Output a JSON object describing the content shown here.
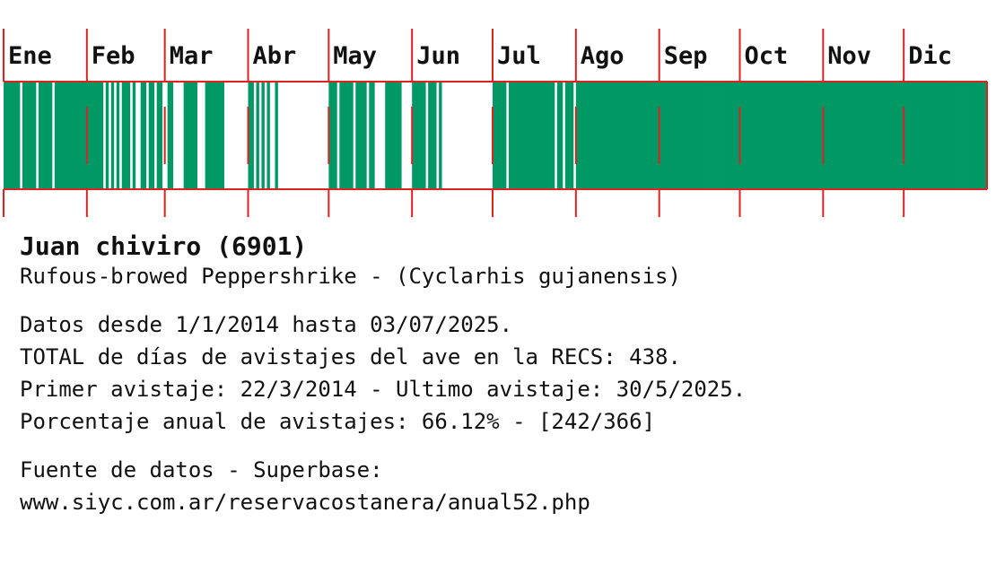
{
  "chart_data": {
    "type": "bar",
    "categories": [
      "Ene",
      "Feb",
      "Mar",
      "Abr",
      "May",
      "Jun",
      "Jul",
      "Ago",
      "Sep",
      "Oct",
      "Nov",
      "Dic"
    ],
    "month_days": [
      31,
      29,
      31,
      30,
      31,
      30,
      31,
      31,
      30,
      31,
      30,
      31
    ],
    "sighting_days": [
      [
        1,
        2,
        3,
        4,
        5,
        6,
        8,
        9,
        10,
        11,
        12,
        14,
        15,
        16,
        17,
        18,
        20,
        21,
        22,
        23,
        24,
        25,
        26,
        27,
        28,
        29,
        30,
        31
      ],
      [
        1,
        2,
        3,
        4,
        5,
        6,
        8,
        10,
        12,
        14,
        15,
        16,
        18,
        21,
        22,
        24,
        25,
        27,
        28
      ],
      [
        2,
        3,
        8,
        9,
        10,
        11,
        12,
        16,
        17,
        18,
        19,
        20,
        21,
        22
      ],
      [
        1,
        2,
        4,
        6,
        8,
        11
      ],
      [
        1,
        2,
        3,
        5,
        6,
        7,
        8,
        9,
        11,
        12,
        13,
        14,
        16,
        17,
        22,
        23,
        24,
        25,
        26,
        27
      ],
      [
        1,
        2,
        3,
        4,
        5,
        7,
        8,
        9,
        11
      ],
      [
        1,
        2,
        3,
        4,
        5,
        7,
        8,
        9,
        10,
        11,
        12,
        13,
        14,
        15,
        16,
        17,
        18,
        19,
        20,
        21,
        22,
        23,
        25,
        26,
        28,
        29,
        30
      ],
      [
        1,
        2,
        3,
        4,
        5,
        6,
        7,
        8,
        9,
        10,
        11,
        12,
        13,
        14,
        15,
        16,
        17,
        18,
        19,
        20,
        21,
        22,
        23,
        24,
        25,
        26,
        27,
        28,
        29,
        30,
        31
      ],
      [
        1,
        2,
        3,
        4,
        5,
        6,
        7,
        8,
        9,
        10,
        11,
        12,
        13,
        14,
        15,
        16,
        17,
        18,
        19,
        20,
        21,
        22,
        23,
        24,
        25,
        26,
        27,
        28,
        29,
        30
      ],
      [
        1,
        2,
        3,
        4,
        5,
        6,
        7,
        8,
        9,
        10,
        11,
        12,
        13,
        14,
        15,
        16,
        17,
        18,
        19,
        20,
        21,
        22,
        23,
        24,
        25,
        26,
        27,
        28,
        29,
        30,
        31
      ],
      [
        1,
        2,
        3,
        4,
        5,
        6,
        7,
        8,
        9,
        10,
        11,
        12,
        13,
        14,
        15,
        16,
        17,
        18,
        19,
        20,
        21,
        22,
        23,
        24,
        25,
        26,
        27,
        28,
        29,
        30
      ],
      [
        1,
        2,
        3,
        4,
        5,
        6,
        7,
        8,
        9,
        10,
        11,
        12,
        13,
        14,
        15,
        16,
        17,
        18,
        19,
        20,
        21,
        22,
        23,
        24,
        25,
        26,
        27,
        28,
        29,
        30,
        31
      ]
    ],
    "colors": {
      "bar": "#009966",
      "grid": "#dd2222",
      "background": "#ffffff",
      "text": "#111111"
    }
  },
  "species": {
    "common_name": "Juan chiviro (6901)",
    "scientific_line": "Rufous-browed Peppershrike - (Cyclarhis gujanensis)"
  },
  "stats": {
    "range": "Datos desde 1/1/2014 hasta 03/07/2025.",
    "total": "TOTAL de días de avistajes del ave en la RECS: 438.",
    "first_last": "Primer avistaje: 22/3/2014 - Ultimo avistaje: 30/5/2025.",
    "percent": "Porcentaje anual de avistajes: 66.12% - [242/366]"
  },
  "source": {
    "label": "Fuente de datos - Superbase:",
    "url": "www.siyc.com.ar/reservacostanera/anual52.php"
  }
}
